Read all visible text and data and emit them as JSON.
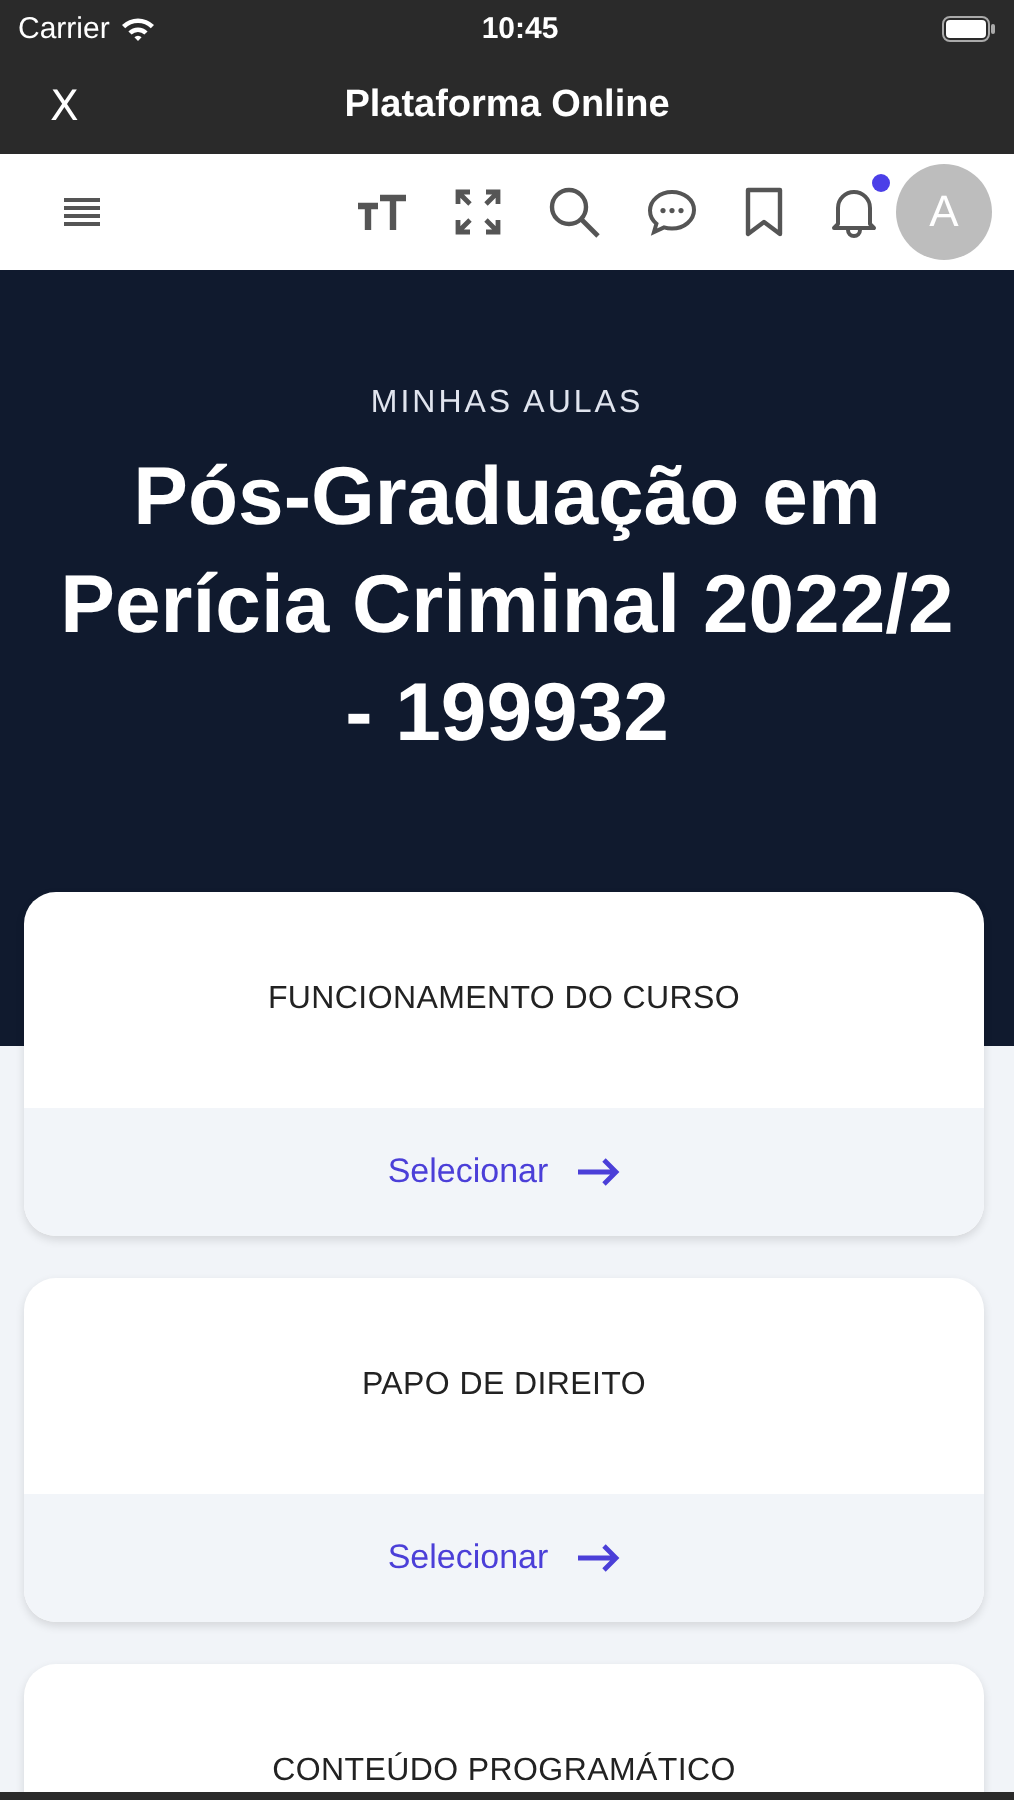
{
  "status_bar": {
    "carrier": "Carrier",
    "time": "10:45"
  },
  "nav_bar": {
    "close": "X",
    "title": "Plataforma Online"
  },
  "toolbar": {
    "notifications_unread": true,
    "avatar": "A"
  },
  "hero": {
    "label": "MINHAS AULAS",
    "title": "Pós-Graduação em Perícia Criminal 2022/2 - 199932"
  },
  "courses": [
    {
      "title": "FUNCIONAMENTO DO CURSO",
      "action": "Selecionar"
    },
    {
      "title": "PAPO DE DIREITO",
      "action": "Selecionar"
    },
    {
      "title": "CONTEÚDO PROGRAMÁTICO"
    }
  ]
}
